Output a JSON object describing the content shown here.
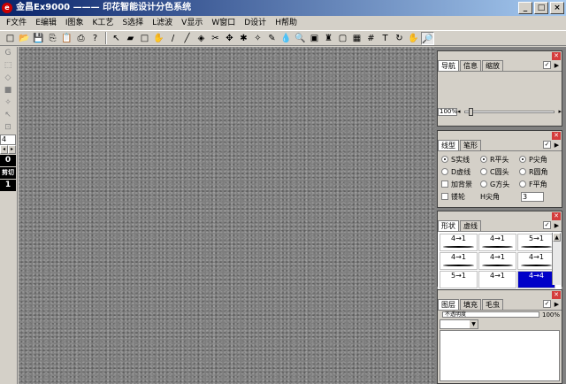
{
  "window": {
    "title": "金昌Ex9000 ——— 印花智能设计分色系统",
    "app_icon": "ex9000-app-icon",
    "buttons": [
      "_",
      "□",
      "×"
    ]
  },
  "menu": [
    "F文件",
    "E编辑",
    "I图象",
    "K工艺",
    "S选择",
    "L滤波",
    "V显示",
    "W窗口",
    "D设计",
    "H帮助"
  ],
  "toolbar": {
    "icons": [
      "new-file-icon",
      "open-folder-icon",
      "save-icon",
      "copy-icon",
      "paste-icon",
      "print-icon",
      "help-icon",
      "pointer-icon",
      "eraser-icon",
      "rectangle-icon",
      "hand-brush-icon",
      "pen-icon",
      "line-icon",
      "fill-bucket-icon",
      "scissors-icon",
      "transform-icon",
      "spray-icon",
      "magic-wand-icon",
      "brush-icon",
      "drop-icon",
      "magnifier-icon",
      "layer-icon",
      "stamp-icon",
      "frame-icon",
      "image-icon",
      "grid-icon",
      "text-icon",
      "rotate-icon",
      "pan-hand-icon",
      "zoom-icon"
    ],
    "glyphs": [
      "□",
      "📂",
      "💾",
      "⎘",
      "📋",
      "⎙",
      "?",
      "↖",
      "▰",
      "□",
      "✋",
      "/",
      "╱",
      "◈",
      "✂",
      "✥",
      "✱",
      "✧",
      "✎",
      "💧",
      "🔍",
      "▣",
      "♜",
      "▢",
      "▦",
      "#",
      "T",
      "↻",
      "✋",
      "🔎"
    ]
  },
  "left_tools": {
    "glyphs": [
      "G",
      "⬚",
      "◇",
      "■",
      "✧",
      "↖",
      "⊡"
    ],
    "number_value": "4",
    "black_labels": [
      "0",
      "剪切",
      "1"
    ]
  },
  "nav_panel": {
    "tabs": [
      "导航",
      "信息",
      "缩放"
    ],
    "zoom_value": "100%"
  },
  "shape_panel": {
    "tabs": [
      "线型",
      "笔形"
    ],
    "options": [
      "S实线",
      "R平头",
      "P尖角",
      "D虚线",
      "C圆头",
      "R圆角",
      "加背景",
      "G方头",
      "F平角",
      "镂轮",
      "H尖角"
    ],
    "angle_value": "3"
  },
  "brush_panel": {
    "tabs": [
      "形状",
      "虚线"
    ],
    "cells": [
      "4→1",
      "4→1",
      "5→1",
      "4→1",
      "4→1",
      "4→1",
      "5→1",
      "4→1",
      "4→4"
    ]
  },
  "layer_panel": {
    "tabs": [
      "图层",
      "填充",
      "毛虫"
    ],
    "opacity_label": "不透明度",
    "opacity_value": "100%"
  },
  "colors": {
    "titlebar": "#0a246a",
    "canvas": "#7d7d7d",
    "selected_cell": "#0000c8",
    "close_button": "#d43c3c"
  }
}
